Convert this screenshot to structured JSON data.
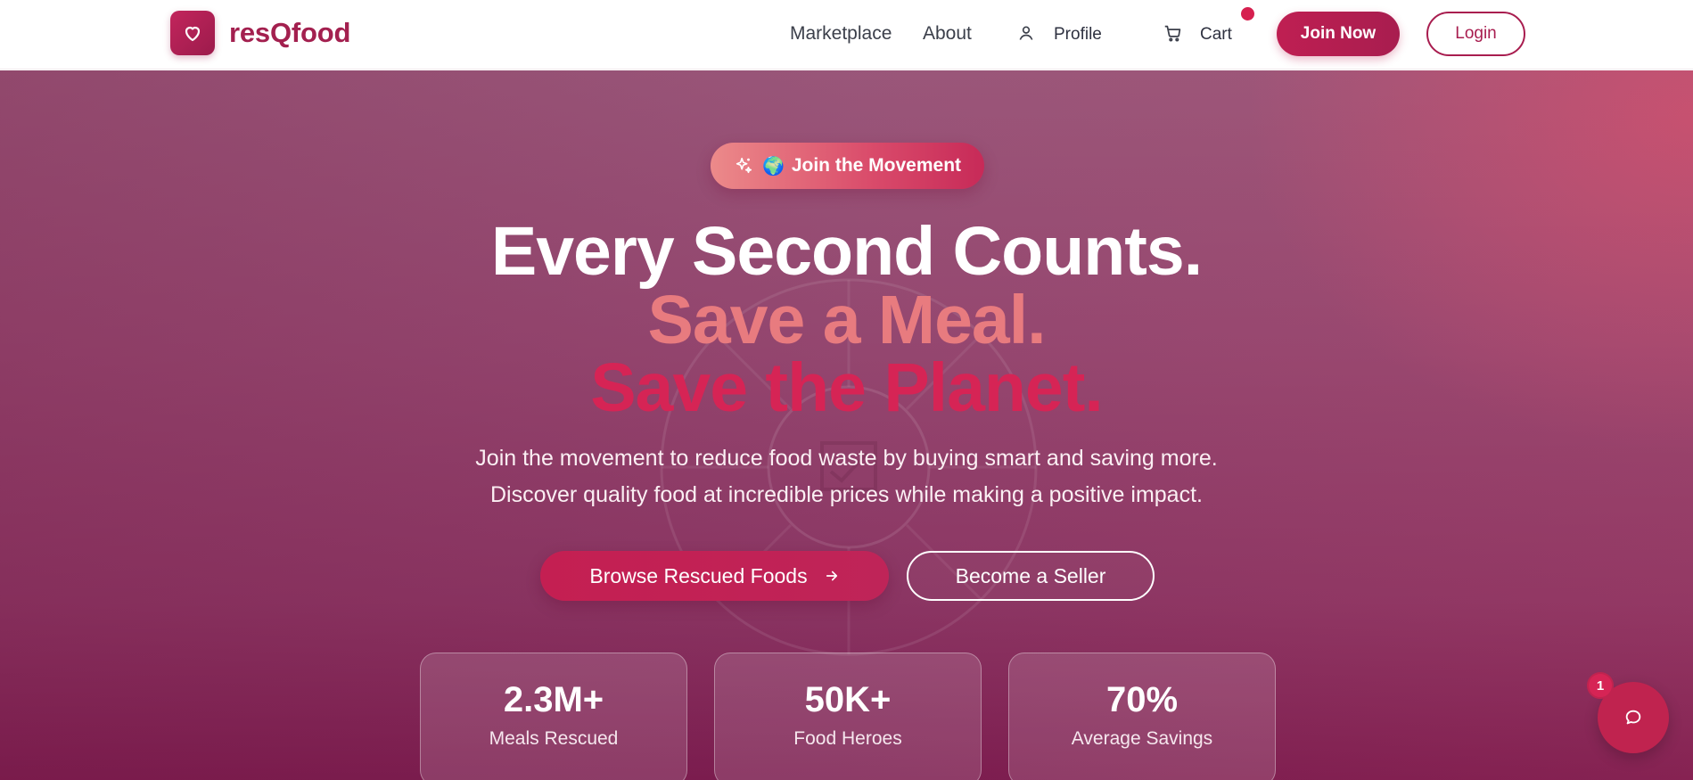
{
  "nav": {
    "brand": "resQfood",
    "links": {
      "marketplace": "Marketplace",
      "about": "About",
      "profile": "Profile",
      "cart": "Cart"
    },
    "join_label": "Join Now",
    "login_label": "Login",
    "icons": {
      "logo": "heart-icon",
      "profile": "user-icon",
      "cart": "cart-icon"
    },
    "cart_has_items": true
  },
  "hero": {
    "pill": {
      "icon": "sparkles-icon",
      "emoji": "🌍",
      "label": "Join the Movement"
    },
    "headline": [
      "Every Second Counts.",
      "Save a Meal.",
      "Save the Planet."
    ],
    "subtext": [
      "Join the movement to reduce food waste by buying smart and saving more.",
      "Discover quality food at incredible prices while making a positive impact."
    ],
    "primary_cta": "Browse Rescued Foods",
    "secondary_cta": "Become a Seller",
    "stats": [
      {
        "value": "2.3M+",
        "label": "Meals Rescued"
      },
      {
        "value": "50K+",
        "label": "Food Heroes"
      },
      {
        "value": "70%",
        "label": "Average Savings"
      }
    ]
  },
  "chat": {
    "icon": "chat-icon",
    "unread": "1"
  },
  "colors": {
    "brand": "#a81d4f",
    "accent": "#d62455",
    "highlight": "#e87b7f"
  }
}
